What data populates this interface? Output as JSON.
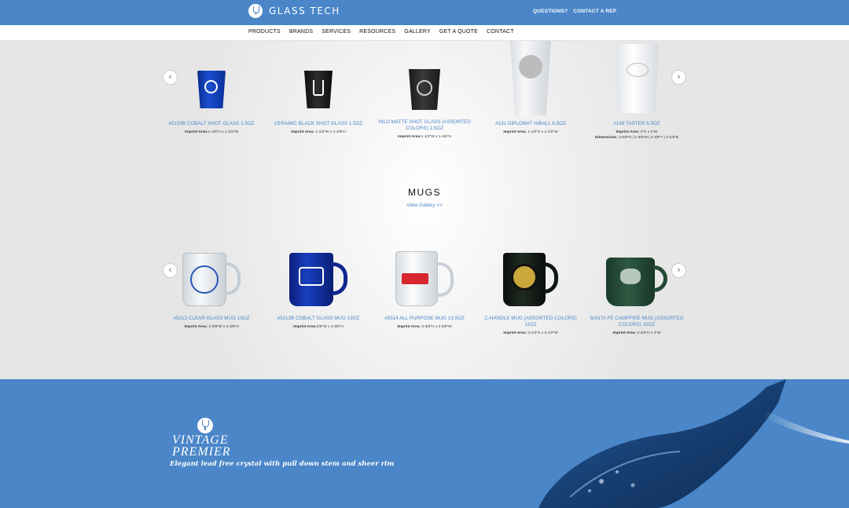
{
  "header": {
    "brand": "GLASS TECH",
    "links": [
      "QUESTIONS?",
      "CONTACT A REP"
    ]
  },
  "nav": {
    "items": [
      "PRODUCTS",
      "BRANDS",
      "SERVICES",
      "RESOURCES",
      "GALLERY",
      "GET A QUOTE",
      "CONTACT"
    ]
  },
  "shot_glasses": {
    "prev": "‹",
    "next": "›",
    "items": [
      {
        "name": "#5120B COBALT SHOT GLASS 1.5oz",
        "imprint_label": "Imprint Area:",
        "imprint_value": "1-1/8\"H x 1-1/2\"W"
      },
      {
        "name": "CERAMIC BLACK SHOT GLASS 1.5oz",
        "imprint_label": "Imprint Area:",
        "imprint_value": "1-1/2\"W x 1-1/8\"H"
      },
      {
        "name": "HILO MATTE SHOT GLASS (ASSORTED COLORS) 1.5oz",
        "imprint_label": "Imprint Area:",
        "imprint_value": "1-1/2\"W x 1-1/8\"H"
      },
      {
        "name": "#131 DIPLOMAT HIBALL 6.5oz",
        "imprint_label": "Imprint Area:",
        "imprint_value": "1-1/2\"H x 1-1/2\"W"
      },
      {
        "name": "#149 TASTER 5.5oz",
        "imprint_label": "Imprint Area:",
        "imprint_value": "2\"H x 2\"W",
        "dimensions_label": "Dimensions:",
        "dimensions_value": "3-5/8\"H | 2-3/8\"M | 2-3/8\"T | 2-1/8\"B"
      }
    ]
  },
  "mugs": {
    "title": "MUGS",
    "view_gallery": "View Gallery >>",
    "prev": "‹",
    "next": "›",
    "items": [
      {
        "name": "#5213 CLEAR GLASS MUG 13oz",
        "imprint_label": "Imprint Area:",
        "imprint_value": "3-3/8\"W x 2-3/8\"H"
      },
      {
        "name": "#5213B COBALT GLASS MUG 13oz",
        "imprint_label": "Imprint Area:",
        "imprint_value": "3/8\"W x 2-3/8\"H"
      },
      {
        "name": "#5514 ALL PURPOSE MUG 13.5oz",
        "imprint_label": "Imprint Area:",
        "imprint_value": "2-3/8\"H x 3-3/8\"W"
      },
      {
        "name": "C-HANDLE MUG (ASSORTED COLORS) 11oz",
        "imprint_label": "Imprint Area:",
        "imprint_value": "3-1/2\"H x 3-1/2\"W"
      },
      {
        "name": "SANTA FE CAMPFIRE MUG (ASSORTED COLORS) 15oz",
        "imprint_label": "Imprint Area:",
        "imprint_value": "2-3/4\"H x 3\"W"
      }
    ]
  },
  "promo": {
    "title_line1": "VINTAGE",
    "title_line2": "PREMIER",
    "subtitle": "Elegant lead free crystal with pull down stem and sheer rim"
  },
  "colors": {
    "brand_blue": "#4a86c8",
    "link_blue": "#4a86c8"
  }
}
